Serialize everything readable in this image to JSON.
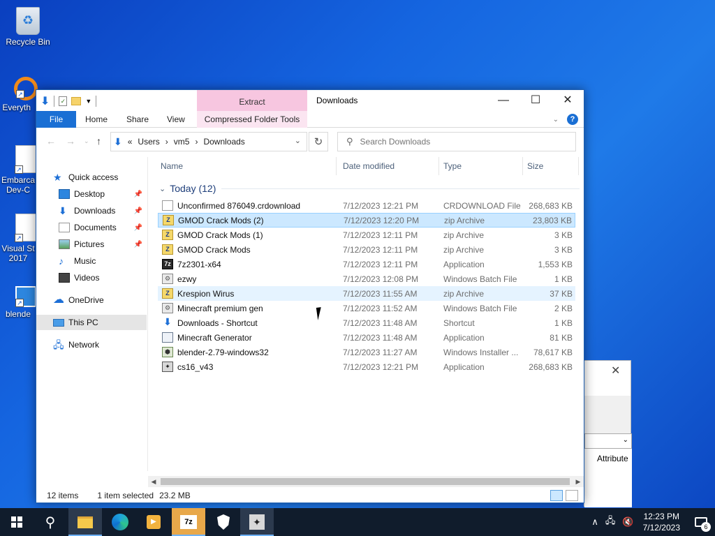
{
  "desktop": {
    "icons": [
      {
        "label": "Recycle Bin"
      },
      {
        "label": "Everyth"
      },
      {
        "label": "Embarca Dev-C"
      },
      {
        "label": "Visual St 2017"
      },
      {
        "label": "blende"
      }
    ]
  },
  "window": {
    "title": "Downloads",
    "context_tab_group": "Extract",
    "controls": {
      "minimize": "—",
      "maximize": "☐",
      "close": "✕"
    }
  },
  "ribbon": {
    "tabs": [
      "File",
      "Home",
      "Share",
      "View",
      "Compressed Folder Tools"
    ]
  },
  "address": {
    "prefix": "«",
    "crumbs": [
      "Users",
      "vm5",
      "Downloads"
    ],
    "sep": "›",
    "search_placeholder": "Search Downloads"
  },
  "nav": {
    "items": [
      {
        "label": "Quick access",
        "pinned": false
      },
      {
        "label": "Desktop",
        "pinned": true
      },
      {
        "label": "Downloads",
        "pinned": true
      },
      {
        "label": "Documents",
        "pinned": true
      },
      {
        "label": "Pictures",
        "pinned": true
      },
      {
        "label": "Music",
        "pinned": false
      },
      {
        "label": "Videos",
        "pinned": false
      },
      {
        "label": "OneDrive",
        "pinned": false
      },
      {
        "label": "This PC",
        "pinned": false
      },
      {
        "label": "Network",
        "pinned": false
      }
    ]
  },
  "columns": {
    "name": "Name",
    "date": "Date modified",
    "type": "Type",
    "size": "Size"
  },
  "group": {
    "label": "Today (12)"
  },
  "files": [
    {
      "name": "Unconfirmed 876049.crdownload",
      "date": "7/12/2023 12:21 PM",
      "type": "CRDOWNLOAD File",
      "size": "268,683 KB",
      "icon": "file-icon"
    },
    {
      "name": "GMOD Crack Mods (2)",
      "date": "7/12/2023 12:20 PM",
      "type": "zip Archive",
      "size": "23,803 KB",
      "icon": "zip-icon"
    },
    {
      "name": "GMOD Crack Mods (1)",
      "date": "7/12/2023 12:11 PM",
      "type": "zip Archive",
      "size": "3 KB",
      "icon": "zip-icon"
    },
    {
      "name": "GMOD Crack Mods",
      "date": "7/12/2023 12:11 PM",
      "type": "zip Archive",
      "size": "3 KB",
      "icon": "zip-icon"
    },
    {
      "name": "7z2301-x64",
      "date": "7/12/2023 12:11 PM",
      "type": "Application",
      "size": "1,553 KB",
      "icon": "7z-icon"
    },
    {
      "name": "ezwy",
      "date": "7/12/2023 12:08 PM",
      "type": "Windows Batch File",
      "size": "1 KB",
      "icon": "batch-icon"
    },
    {
      "name": "Krespion Wirus",
      "date": "7/12/2023 11:55 AM",
      "type": "zip Archive",
      "size": "37 KB",
      "icon": "zip-icon"
    },
    {
      "name": "Minecraft premium gen",
      "date": "7/12/2023 11:52 AM",
      "type": "Windows Batch File",
      "size": "2 KB",
      "icon": "batch-icon"
    },
    {
      "name": "Downloads - Shortcut",
      "date": "7/12/2023 11:48 AM",
      "type": "Shortcut",
      "size": "1 KB",
      "icon": "shortcut-icon"
    },
    {
      "name": "Minecraft Generator",
      "date": "7/12/2023 11:48 AM",
      "type": "Application",
      "size": "81 KB",
      "icon": "app-icon"
    },
    {
      "name": "blender-2.79-windows32",
      "date": "7/12/2023 11:27 AM",
      "type": "Windows Installer ...",
      "size": "78,617 KB",
      "icon": "installer-icon"
    },
    {
      "name": "cs16_v43",
      "date": "7/12/2023 12:21 PM",
      "type": "Application",
      "size": "268,683 KB",
      "icon": "cs-icon"
    }
  ],
  "status": {
    "count": "12 items",
    "selected": "1 item selected",
    "selected_size": "23.2 MB"
  },
  "bg_dialog": {
    "close": "✕",
    "attr_label": "Attribute"
  },
  "taskbar": {
    "clock_time": "12:23 PM",
    "clock_date": "7/12/2023",
    "notification_count": "6",
    "seven_zip_label": "7z"
  }
}
